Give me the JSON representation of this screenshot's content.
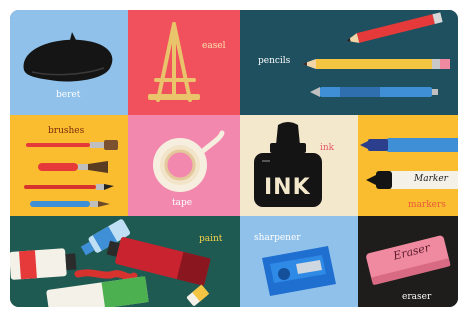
{
  "cards": {
    "beret": {
      "label": "beret",
      "color": "#8fc1ea"
    },
    "easel": {
      "label": "easel",
      "color": "#f1515d"
    },
    "pencils": {
      "label": "pencils",
      "color": "#1e5060"
    },
    "brushes": {
      "label": "brushes",
      "color": "#f9bd2f"
    },
    "tape": {
      "label": "tape",
      "color": "#f288ad"
    },
    "ink": {
      "label": "ink",
      "ink_text": "INK",
      "color": "#f4e8cc"
    },
    "markers": {
      "label": "markers",
      "marker_text": "Marker",
      "color": "#f9bd2f"
    },
    "paint": {
      "label": "paint",
      "color": "#1e5a52"
    },
    "sharpener": {
      "label": "sharpener",
      "color": "#8fc1ea"
    },
    "eraser": {
      "label": "eraser",
      "eraser_text": "Eraser",
      "color": "#1f1c1c"
    }
  }
}
